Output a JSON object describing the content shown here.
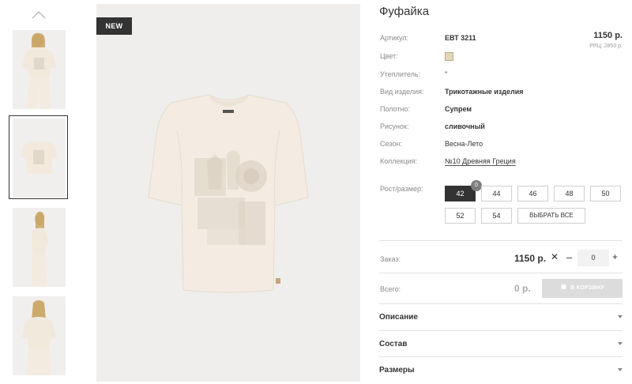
{
  "product": {
    "badge": "NEW",
    "title": "Фуфайка",
    "price": "1150 р.",
    "rrp": "РРЦ: 2850 р."
  },
  "attributes": [
    {
      "label": "Артикул:",
      "value": "ЕВТ 3211"
    },
    {
      "label": "Цвет:",
      "value": ""
    },
    {
      "label": "Утеплитель:",
      "value": "\""
    },
    {
      "label": "Вид изделия:",
      "value": "Трикотажные изделия"
    },
    {
      "label": "Полотно:",
      "value": "Супрем"
    },
    {
      "label": "Рисунок:",
      "value": "сливочный"
    },
    {
      "label": "Сезон:",
      "value": "Весна-Лето"
    },
    {
      "label": "Коллекция:",
      "value": "№10 Древняя Греция"
    }
  ],
  "colors": {
    "swatch": "#e4d7b4",
    "dark": "#333333",
    "cart_disabled": "#dcdcdc"
  },
  "sizes": {
    "label": "Рост/размер:",
    "options": [
      "42",
      "44",
      "46",
      "48",
      "50",
      "52",
      "54"
    ],
    "selected": "42",
    "selected_qty": "0",
    "select_all": "ВЫБРАТЬ ВСЕ"
  },
  "order": {
    "label": "Заказ:",
    "price": "1150 р.",
    "times": "✕",
    "minus": "–",
    "qty": "0",
    "plus": "+"
  },
  "total": {
    "label": "Всего:",
    "price": "0 р.",
    "cart_button": "В КОРЗИНУ"
  },
  "accordion": [
    {
      "label": "Описание"
    },
    {
      "label": "Состав"
    },
    {
      "label": "Размеры"
    }
  ],
  "icons": [
    "chevron-up-icon",
    "cart-icon",
    "caret-down-icon"
  ]
}
